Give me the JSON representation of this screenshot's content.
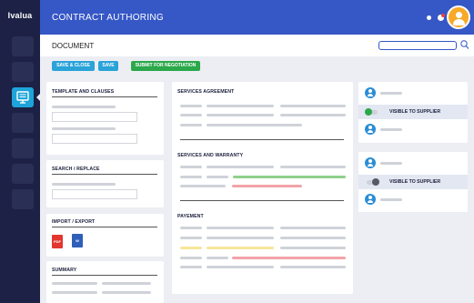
{
  "app": {
    "logo": "Ivalua",
    "title": "CONTRACT AUTHORING"
  },
  "colors": {
    "rail": "#1c2145",
    "header": "#3657c6",
    "active": "#1ea4d8",
    "save_button": "#2aa3d9",
    "submit_button": "#2aa84a",
    "accent_green": "#8fd18c",
    "accent_red": "#f3a3a8",
    "accent_yellow": "#f7e69a",
    "avatar": "#f7a928",
    "person_icon": "#2a8ed6"
  },
  "document": {
    "label": "DOCUMENT"
  },
  "toolbar": {
    "save_close_label": "SAVE & CLOSE",
    "save_label": "SAVE",
    "submit_label": "SUBMIT FOR NEGOTIATION"
  },
  "panels": {
    "templates": "TEMPLATE AND CLAUSES",
    "search_replace": "SEARCH / REPLACE",
    "import_export": "IMPORT / EXPORT",
    "summary": "SUMMARY"
  },
  "files": {
    "pdf": "PDF",
    "word": "W"
  },
  "sections": {
    "services_agreement": "SERVICES AGREEMENT",
    "services_warranty": "SERVICES AND WARRANTY",
    "payement": "PAYEMENT"
  },
  "suppliers": [
    {
      "visible_label": "VISIBLE TO SUPPLIER",
      "visible": true
    },
    {
      "visible_label": "VISIBLE TO SUPPLIER",
      "visible": false
    }
  ]
}
